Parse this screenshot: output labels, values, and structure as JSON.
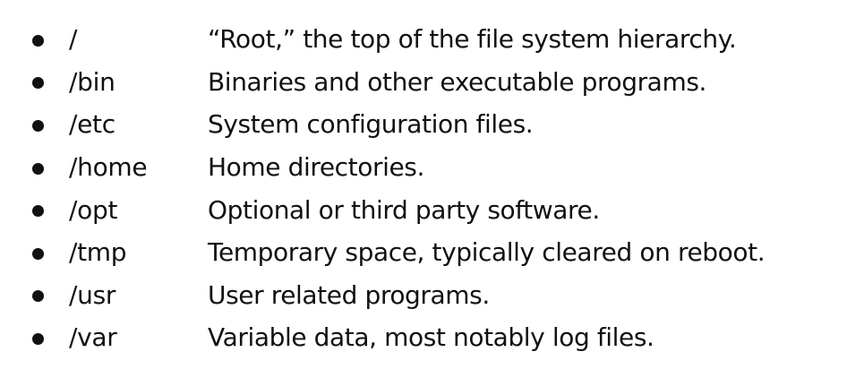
{
  "entries": [
    {
      "path": "/",
      "description": "“Root,” the top of the file system hierarchy."
    },
    {
      "path": "/bin",
      "description": "Binaries and other executable programs."
    },
    {
      "path": "/etc",
      "description": "System configuration files."
    },
    {
      "path": "/home",
      "description": "Home directories."
    },
    {
      "path": "/opt",
      "description": "Optional or third party software."
    },
    {
      "path": "/tmp",
      "description": "Temporary space, typically cleared on reboot."
    },
    {
      "path": "/usr",
      "description": "User related programs."
    },
    {
      "path": "/var",
      "description": "Variable data, most notably log files."
    }
  ]
}
